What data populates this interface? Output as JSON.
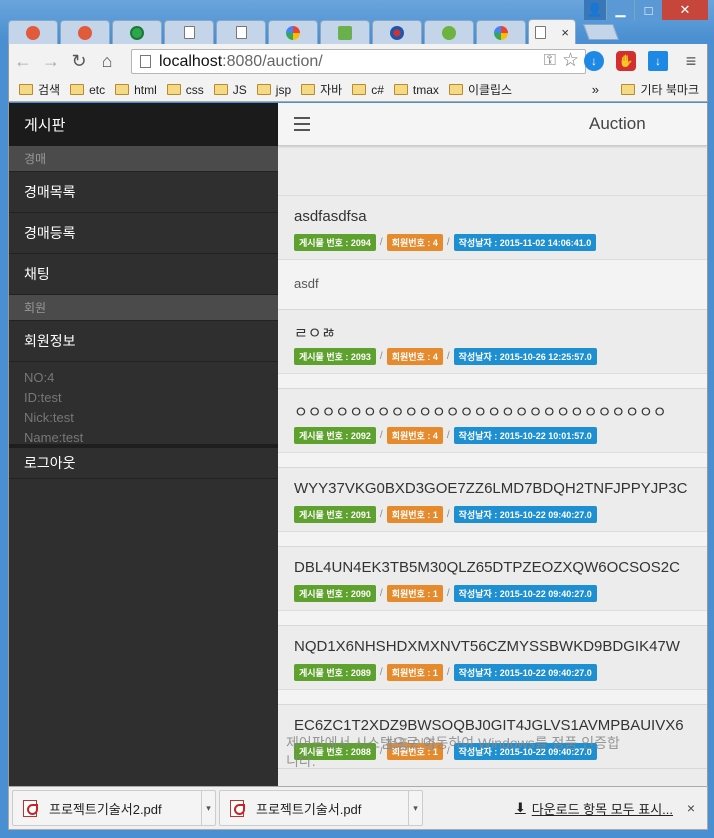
{
  "window": {
    "controls": {
      "user": "👤",
      "minimize": "▁",
      "maximize": "□",
      "close": "✕"
    }
  },
  "tabs": {
    "active_close": "×"
  },
  "toolbar": {
    "back": "←",
    "forward": "→",
    "reload": "↻",
    "home": "⌂",
    "url_host": "localhost",
    "url_path": ":8080/auction/",
    "key_icon": "⚿",
    "star_icon": "☆",
    "menu_icon": "≡"
  },
  "bookmarks": {
    "items": [
      "검색",
      "etc",
      "html",
      "css",
      "JS",
      "jsp",
      "자바",
      "c#",
      "tmax",
      "이클립스"
    ],
    "more": "»",
    "other": "기타 북마크"
  },
  "sidebar": {
    "title": "게시판",
    "section_auction": "경매",
    "auction_list": "경매목록",
    "auction_register": "경매등록",
    "chat": "채팅",
    "section_member": "회원",
    "member_info": "회원정보",
    "user": {
      "no": "NO:4",
      "id": "ID:test",
      "nick": "Nick:test",
      "name": "Name:test"
    },
    "logout": "로그아웃"
  },
  "appbar": {
    "title": "Auction"
  },
  "posts": [
    {
      "title": "asdfasdfsa",
      "num": "게시물 번호 : 2094",
      "member": "회원번호 : 4",
      "date": "작성날자 : 2015-11-02 14:06:41.0",
      "body": "asdf"
    },
    {
      "title": "ㄹㅇㅀ",
      "num": "게시물 번호 : 2093",
      "member": "회원번호 : 4",
      "date": "작성날자 : 2015-10-26 12:25:57.0",
      "body": ""
    },
    {
      "title": "ㅇㅇㅇㅇㅇㅇㅇㅇㅇㅇㅇㅇㅇㅇㅇㅇㅇㅇㅇㅇㅇㅇㅇㅇㅇㅇㅇ",
      "num": "게시물 번호 : 2092",
      "member": "회원번호 : 4",
      "date": "작성날자 : 2015-10-22 10:01:57.0",
      "body": ""
    },
    {
      "title": "WYY37VKG0BXD3GOE7ZZ6LMD7BDQH2TNFJPPYJP3C",
      "num": "게시물 번호 : 2091",
      "member": "회원번호 : 1",
      "date": "작성날자 : 2015-10-22 09:40:27.0",
      "body": ""
    },
    {
      "title": "DBL4UN4EK3TB5M30QLZ65DTPZEOZXQW6OCSOS2C",
      "num": "게시물 번호 : 2090",
      "member": "회원번호 : 1",
      "date": "작성날자 : 2015-10-22 09:40:27.0",
      "body": ""
    },
    {
      "title": "NQD1X6NHSHDXMXNVT56CZMYSSBWKD9BDGIK47W",
      "num": "게시물 번호 : 2089",
      "member": "회원번호 : 1",
      "date": "작성날자 : 2015-10-22 09:40:27.0",
      "body": ""
    },
    {
      "title": "EC6ZC1T2XDZ9BWSOQBJ0GIT4JGLVS1AVMPBAUIVX6",
      "num": "게시물 번호 : 2088",
      "member": "회원번호 : 1",
      "date": "작성날자 : 2015-10-22 09:40:27.0",
      "body": ""
    }
  ],
  "watermark": {
    "title": "정품 인증",
    "line1": "제어판에서 시스템으로 이동하여 Windows를 정품 인증합",
    "line2": "니다."
  },
  "downloads": {
    "items": [
      "프로젝트기술서2.pdf",
      "프로젝트기술서.pdf"
    ],
    "show_all": "다운로드 항목 모두 표시...",
    "close": "×",
    "arrow": "▾",
    "download_icon": "⬇"
  },
  "colors": {
    "badge_num": "#5fa12e",
    "badge_member": "#e68a2e",
    "badge_date": "#1e8fd0",
    "sidebar": "#2f2f2f"
  }
}
